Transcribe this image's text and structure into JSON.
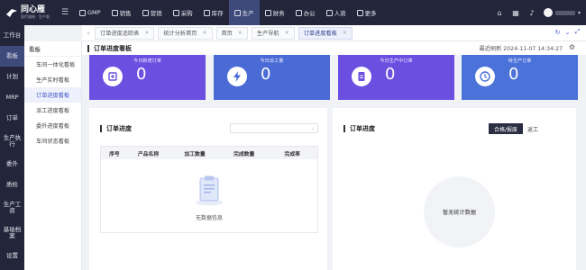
{
  "app": {
    "logo_title": "同心雁",
    "logo_subtitle": "医疗器械 · 生产版"
  },
  "top_nav": [
    {
      "label": "GMP",
      "icon": "gmp-icon"
    },
    {
      "label": "销售",
      "icon": "sales-icon"
    },
    {
      "label": "营销",
      "icon": "marketing-icon"
    },
    {
      "label": "采购",
      "icon": "cart-icon"
    },
    {
      "label": "库存",
      "icon": "warehouse-icon"
    },
    {
      "label": "生产",
      "icon": "production-icon",
      "active": true
    },
    {
      "label": "财务",
      "icon": "finance-icon"
    },
    {
      "label": "办公",
      "icon": "office-icon"
    },
    {
      "label": "人资",
      "icon": "hr-icon"
    },
    {
      "label": "更多",
      "icon": "more-icon"
    }
  ],
  "sidebar": [
    {
      "label": "工作台"
    },
    {
      "label": "看板",
      "active": true
    },
    {
      "label": "计划"
    },
    {
      "label": "MRP"
    },
    {
      "label": "订单"
    },
    {
      "label": "生产执行"
    },
    {
      "label": "委外"
    },
    {
      "label": "质检"
    },
    {
      "label": "生产工资"
    },
    {
      "label": "基础档案"
    },
    {
      "label": "设置"
    }
  ],
  "subnav": {
    "heading": "看板",
    "items": [
      {
        "label": "车间一体化看板"
      },
      {
        "label": "生产实时看板"
      },
      {
        "label": "订单进度看板",
        "active": true
      },
      {
        "label": "派工进度看板"
      },
      {
        "label": "委外进度看板"
      },
      {
        "label": "车间状态看板"
      }
    ]
  },
  "tabs": [
    {
      "label": "订单进度追踪表"
    },
    {
      "label": "统计分析首页"
    },
    {
      "label": "首页"
    },
    {
      "label": "生产导航"
    },
    {
      "label": "订单进度看板",
      "active": true
    }
  ],
  "header": {
    "title": "订单进度看板",
    "refresh": "最近刷新 2024-11-07 14:34:27"
  },
  "cards": [
    {
      "label": "今日新增订单",
      "value": "0",
      "color": "#6a4fe0",
      "icon": "new-order-icon"
    },
    {
      "label": "今日派工量",
      "value": "0",
      "color": "#4a6bd6",
      "icon": "lightning-icon"
    },
    {
      "label": "今日生产中订单",
      "value": "0",
      "color": "#6a4fe0",
      "icon": "document-icon"
    },
    {
      "label": "待生产订单",
      "value": "0",
      "color": "#4a72d8",
      "icon": "clock-icon"
    }
  ],
  "left_panel": {
    "title": "订单进度",
    "columns": [
      "序号",
      "产品名称",
      "加工数量",
      "完成数量",
      "完成率"
    ],
    "empty_text": "无数据信息"
  },
  "right_panel": {
    "title": "订单进度",
    "toggle_active": "合格/报废",
    "toggle_other": "返工",
    "empty_text": "暂无统计数据"
  }
}
